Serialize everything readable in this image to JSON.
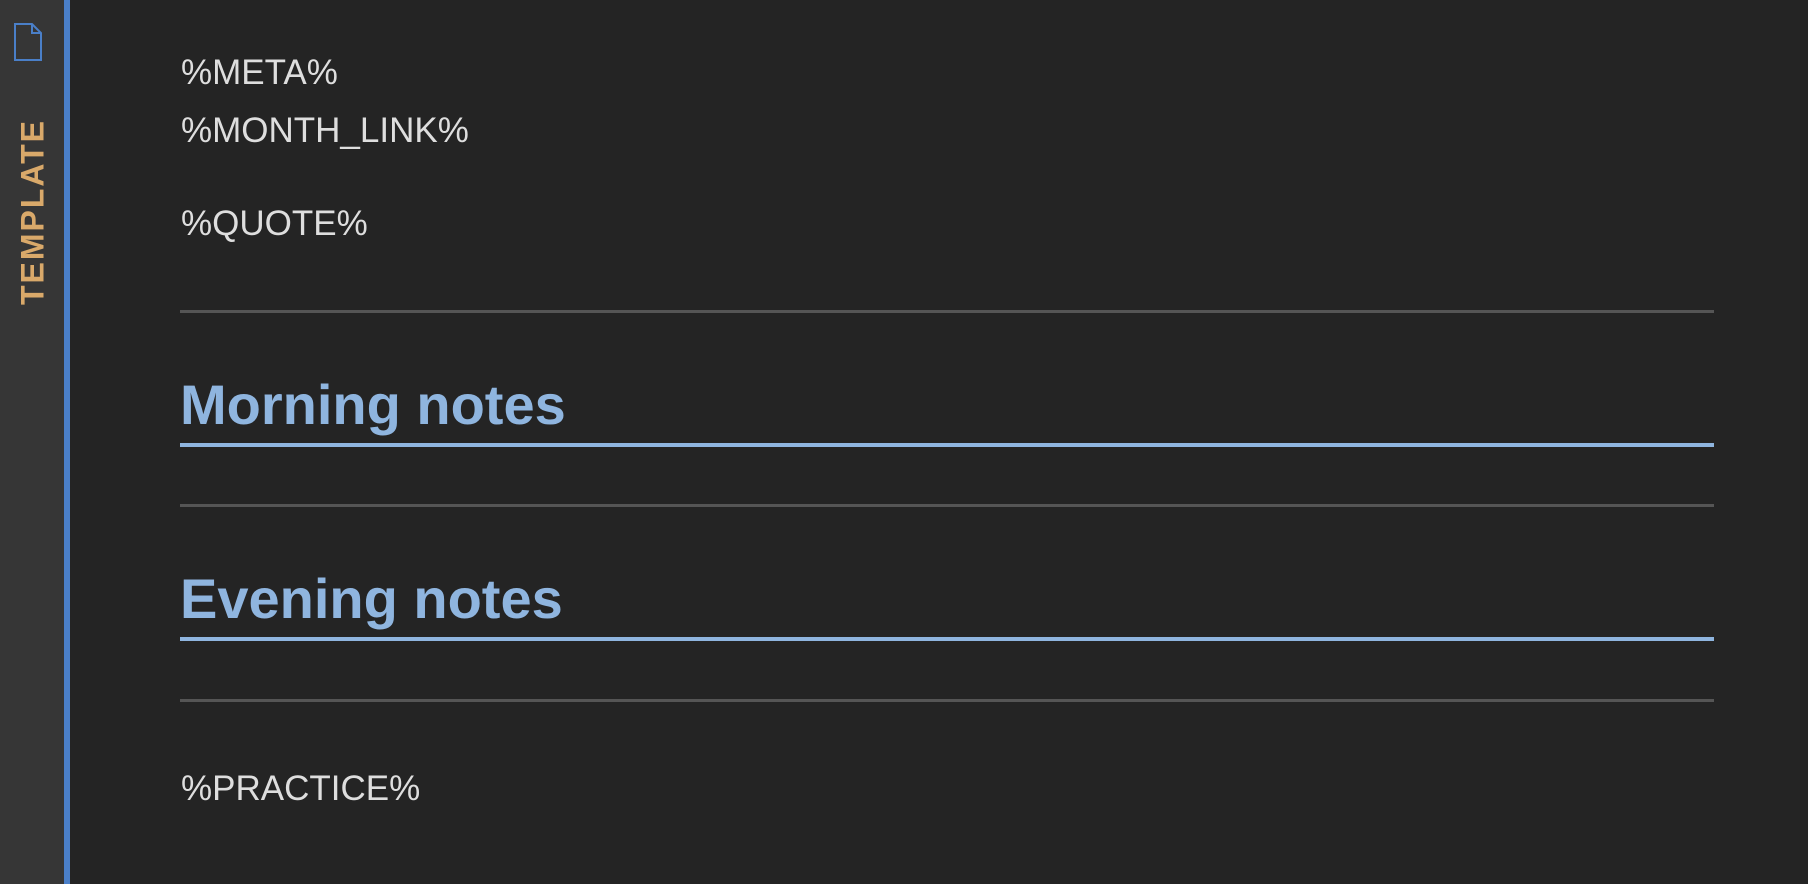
{
  "colors": {
    "background": "#242424",
    "tab_strip": "#363636",
    "tab_accent": "#4a7fc8",
    "tab_label": "#d9a96a",
    "body_text": "#dedede",
    "heading": "#8fb5df",
    "rule": "#555555"
  },
  "sidebar": {
    "icon": "document-icon",
    "tab_label": "TEMPLATE"
  },
  "editor": {
    "lines": {
      "meta": "%META%",
      "month_link": "%MONTH_LINK%",
      "quote": "%QUOTE%",
      "practice": "%PRACTICE%"
    },
    "headings": {
      "morning": "Morning notes",
      "evening": "Evening notes"
    }
  }
}
